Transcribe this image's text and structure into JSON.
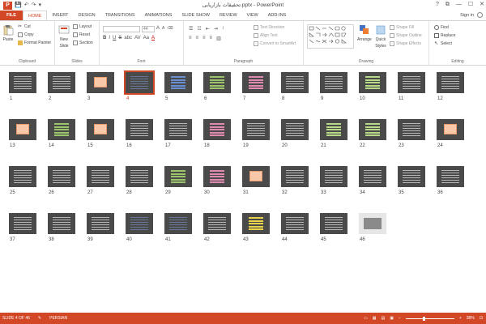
{
  "window": {
    "title": "تحقیقات بازاریابی.pptx - PowerPoint",
    "app_logo": "P",
    "qat": {
      "save": "💾",
      "undo": "↶",
      "redo": "↷",
      "customize": "▾"
    },
    "controls": {
      "help": "?",
      "restore": "⧉",
      "minimize": "—",
      "maximize": "☐",
      "close": "✕"
    }
  },
  "tabs": [
    {
      "label": "FILE"
    },
    {
      "label": "HOME"
    },
    {
      "label": "INSERT"
    },
    {
      "label": "DESIGN"
    },
    {
      "label": "TRANSITIONS"
    },
    {
      "label": "ANIMATIONS"
    },
    {
      "label": "SLIDE SHOW"
    },
    {
      "label": "REVIEW"
    },
    {
      "label": "VIEW"
    },
    {
      "label": "ADD-INS"
    }
  ],
  "signin": "Sign in",
  "ribbon": {
    "clipboard": {
      "paste": "Paste",
      "cut": "Cut",
      "copy": "Copy",
      "format_painter": "Format Painter",
      "label": "Clipboard"
    },
    "slides": {
      "new_slide": "New",
      "new_slide2": "Slide",
      "layout": "Layout",
      "reset": "Reset",
      "section": "Section",
      "label": "Slides"
    },
    "font": {
      "size": "44",
      "label": "Font",
      "bold": "B",
      "italic": "I",
      "underline": "U",
      "strike": "S",
      "shadow": "abc",
      "spacing": "AV",
      "case": "Aa",
      "color": "A"
    },
    "paragraph": {
      "text_direction": "Text Direction",
      "align_text": "Align Text",
      "convert_smartart": "Convert to SmartArt",
      "label": "Paragraph"
    },
    "drawing": {
      "arrange": "Arrange",
      "quick_styles": "Quick",
      "quick_styles2": "Styles",
      "shape_fill": "Shape Fill",
      "shape_outline": "Shape Outline",
      "shape_effects": "Shape Effects",
      "label": "Drawing"
    },
    "editing": {
      "find": "Find",
      "replace": "Replace",
      "select": "Select",
      "label": "Editing"
    }
  },
  "slides": [
    {
      "n": "1",
      "kind": "text"
    },
    {
      "n": "2",
      "kind": "text"
    },
    {
      "n": "3",
      "kind": "card"
    },
    {
      "n": "4",
      "kind": "dark",
      "selected": true
    },
    {
      "n": "5",
      "kind": "bars"
    },
    {
      "n": "6",
      "kind": "green"
    },
    {
      "n": "7",
      "kind": "pink"
    },
    {
      "n": "8",
      "kind": "text"
    },
    {
      "n": "9",
      "kind": "text"
    },
    {
      "n": "10",
      "kind": "table"
    },
    {
      "n": "11",
      "kind": "text"
    },
    {
      "n": "12",
      "kind": "text"
    },
    {
      "n": "13",
      "kind": "card"
    },
    {
      "n": "14",
      "kind": "green"
    },
    {
      "n": "15",
      "kind": "card"
    },
    {
      "n": "16",
      "kind": "text"
    },
    {
      "n": "17",
      "kind": "text"
    },
    {
      "n": "18",
      "kind": "pink"
    },
    {
      "n": "19",
      "kind": "text"
    },
    {
      "n": "20",
      "kind": "text"
    },
    {
      "n": "21",
      "kind": "table"
    },
    {
      "n": "22",
      "kind": "table"
    },
    {
      "n": "23",
      "kind": "text"
    },
    {
      "n": "24",
      "kind": "card"
    },
    {
      "n": "25",
      "kind": "text"
    },
    {
      "n": "26",
      "kind": "text"
    },
    {
      "n": "27",
      "kind": "text"
    },
    {
      "n": "28",
      "kind": "text"
    },
    {
      "n": "29",
      "kind": "green"
    },
    {
      "n": "30",
      "kind": "pink"
    },
    {
      "n": "31",
      "kind": "card"
    },
    {
      "n": "32",
      "kind": "text"
    },
    {
      "n": "33",
      "kind": "text"
    },
    {
      "n": "34",
      "kind": "text"
    },
    {
      "n": "35",
      "kind": "text"
    },
    {
      "n": "36",
      "kind": "text"
    },
    {
      "n": "37",
      "kind": "text"
    },
    {
      "n": "38",
      "kind": "text"
    },
    {
      "n": "39",
      "kind": "text"
    },
    {
      "n": "40",
      "kind": "dark"
    },
    {
      "n": "41",
      "kind": "dark"
    },
    {
      "n": "42",
      "kind": "text"
    },
    {
      "n": "43",
      "kind": "yellow"
    },
    {
      "n": "44",
      "kind": "text"
    },
    {
      "n": "45",
      "kind": "text"
    },
    {
      "n": "46",
      "kind": "photo"
    }
  ],
  "status": {
    "slide": "SLIDE 4 OF 46",
    "language": "PERSIAN",
    "zoom": "38%",
    "zoom_fraction": 0.38
  },
  "colors": {
    "accent": "#d24726",
    "thumb_bg": "#4a4a4a"
  }
}
